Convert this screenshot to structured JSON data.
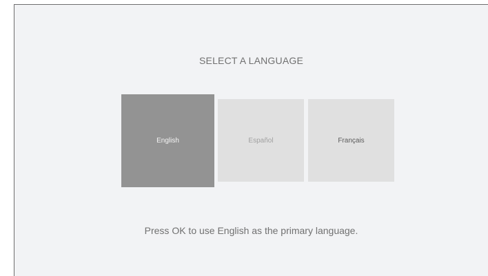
{
  "screen": {
    "title": "SELECT A LANGUAGE",
    "languages": [
      {
        "label": "English",
        "selected": true
      },
      {
        "label": "Español",
        "selected": false
      },
      {
        "label": "Français",
        "selected": false
      }
    ],
    "hint": "Press OK to use English as the primary language."
  },
  "colors": {
    "background": "#f2f3f5",
    "selected_tile": "#939393",
    "tile": "#e0e0e0",
    "text": "#707070"
  }
}
